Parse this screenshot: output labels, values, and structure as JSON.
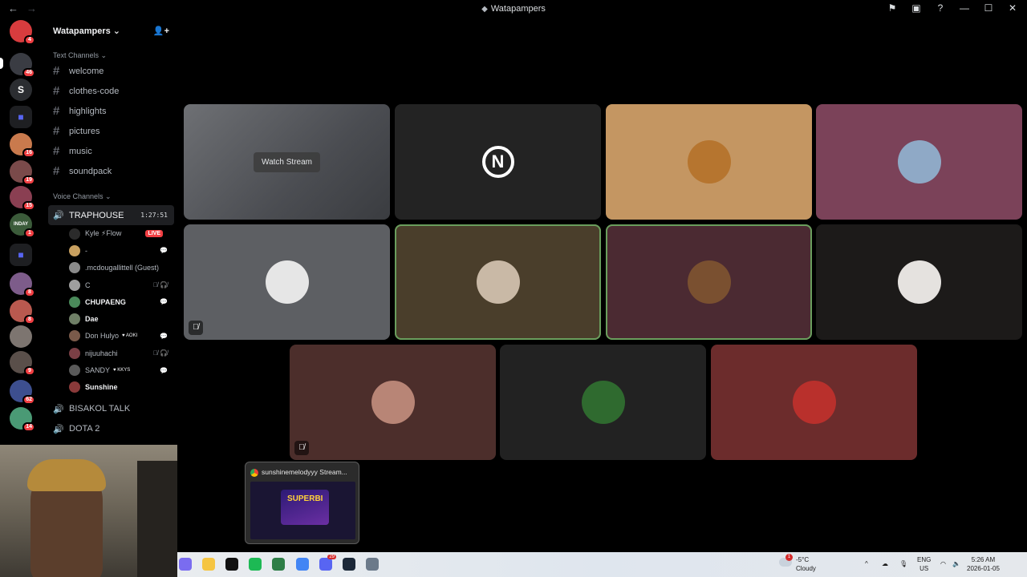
{
  "window": {
    "title": "Watapampers",
    "nav_back": "←",
    "nav_forward": "→",
    "controls": [
      "⚑",
      "▣",
      "?",
      "—",
      "☐",
      "✕"
    ]
  },
  "rail": {
    "servers": [
      {
        "label": "",
        "badge": "4"
      },
      {
        "label": "",
        "badge": "46"
      },
      {
        "label": "S",
        "badge": ""
      },
      {
        "label": "■",
        "badge": ""
      },
      {
        "label": "",
        "badge": "16"
      },
      {
        "label": "",
        "badge": "19"
      },
      {
        "label": "",
        "badge": "15"
      },
      {
        "label": "INDAY",
        "badge": "1"
      },
      {
        "label": "■",
        "badge": ""
      },
      {
        "label": "",
        "badge": "8"
      },
      {
        "label": "",
        "badge": "8"
      },
      {
        "label": "",
        "badge": ""
      },
      {
        "label": "",
        "badge": "9"
      },
      {
        "label": "",
        "badge": "62"
      },
      {
        "label": "",
        "badge": "14"
      }
    ]
  },
  "sidebar": {
    "server_name": "Watapampers",
    "text_category": "Text Channels",
    "text_channels": [
      "welcome",
      "clothes-code",
      "highlights",
      "pictures",
      "music",
      "soundpack"
    ],
    "voice_category": "Voice Channels",
    "active_voice": {
      "name": "TRAPHOUSE",
      "timer": "1:27:51"
    },
    "voice_users": [
      {
        "name": "Kyle ⚡Flow",
        "live": "LIVE",
        "ind": "",
        "tag": "",
        "bold": false
      },
      {
        "name": "-",
        "live": "",
        "ind": "💬",
        "tag": "",
        "bold": false
      },
      {
        "name": ".mcdougallittell (Guest)",
        "live": "",
        "ind": "",
        "tag": "",
        "bold": false
      },
      {
        "name": "C",
        "live": "",
        "ind": "🎙̸ 🎧̸",
        "tag": "",
        "bold": false
      },
      {
        "name": "CHUPAENG",
        "live": "",
        "ind": "💬",
        "tag": "",
        "bold": true
      },
      {
        "name": "Dae",
        "live": "",
        "ind": "",
        "tag": "",
        "bold": true
      },
      {
        "name": "Don Hulyo",
        "live": "",
        "ind": "💬",
        "tag": "♥ AOKI",
        "bold": false
      },
      {
        "name": "nijuuhachi",
        "live": "",
        "ind": "🎙̸ 🎧̸",
        "tag": "",
        "bold": false
      },
      {
        "name": "SANDY",
        "live": "",
        "ind": "💬",
        "tag": "♥ KKYS",
        "bold": false
      },
      {
        "name": "Sunshine",
        "live": "",
        "ind": "",
        "tag": "",
        "bold": true
      }
    ],
    "other_voice": [
      "BISAKOL TALK",
      "DOTA 2"
    ]
  },
  "stage": {
    "watch_label": "Watch Stream",
    "tiles": [
      {
        "bg": "#55575c",
        "type": "stream",
        "speaking": false,
        "muted": false
      },
      {
        "bg": "#232323",
        "type": "logo",
        "speaking": false,
        "muted": false
      },
      {
        "bg": "#c49662",
        "type": "avatar",
        "av": "#b6752f",
        "speaking": false,
        "muted": false
      },
      {
        "bg": "#7b4259",
        "type": "avatar",
        "av": "#8fa9c6",
        "speaking": false,
        "muted": false
      },
      {
        "bg": "#5d5f63",
        "type": "avatar",
        "av": "#e6e6e6",
        "speaking": false,
        "muted": true
      },
      {
        "bg": "#4a3e2b",
        "type": "avatar",
        "av": "#c9b9a6",
        "speaking": true,
        "muted": false
      },
      {
        "bg": "#4b2a32",
        "type": "avatar",
        "av": "#7a5030",
        "speaking": true,
        "muted": false
      },
      {
        "bg": "#1c1a19",
        "type": "avatar",
        "av": "#e5e2df",
        "speaking": false,
        "muted": false
      },
      {
        "bg": "#4c2e2b",
        "type": "avatar",
        "av": "#b88576",
        "speaking": false,
        "muted": true
      },
      {
        "bg": "#222222",
        "type": "avatar",
        "av": "#2f6a2f",
        "speaking": false,
        "muted": false
      },
      {
        "bg": "#6c2c2c",
        "type": "avatar",
        "av": "#b9302c",
        "speaking": false,
        "muted": false
      }
    ],
    "logo_letter": "N",
    "mute_glyph": "🎙̸"
  },
  "preview": {
    "title": "sunshinemelodyyy Stream...",
    "slot_text": "SUPERBI"
  },
  "taskbar": {
    "icons": [
      {
        "name": "copilot-icon",
        "color": "#7a6cf0",
        "badge": ""
      },
      {
        "name": "file-explorer-icon",
        "color": "#f5c542",
        "badge": ""
      },
      {
        "name": "tiktok-icon",
        "color": "#111111",
        "badge": ""
      },
      {
        "name": "spotify-icon",
        "color": "#1db954",
        "badge": ""
      },
      {
        "name": "app-icon",
        "color": "#2d7d46",
        "badge": ""
      },
      {
        "name": "chrome-icon",
        "color": "#4285f4",
        "badge": ""
      },
      {
        "name": "discord-icon",
        "color": "#5865f2",
        "badge": "29"
      },
      {
        "name": "steam-icon",
        "color": "#1b2838",
        "badge": ""
      },
      {
        "name": "settings-icon",
        "color": "#6b7a8a",
        "badge": ""
      }
    ],
    "weather": {
      "temp": "-5°C",
      "cond": "Cloudy",
      "badge": "1"
    },
    "lang": {
      "top": "ENG",
      "bottom": "US"
    },
    "clock": {
      "time": "5:26 AM",
      "date": "2026-01-05"
    },
    "tray_chevron": "^"
  }
}
